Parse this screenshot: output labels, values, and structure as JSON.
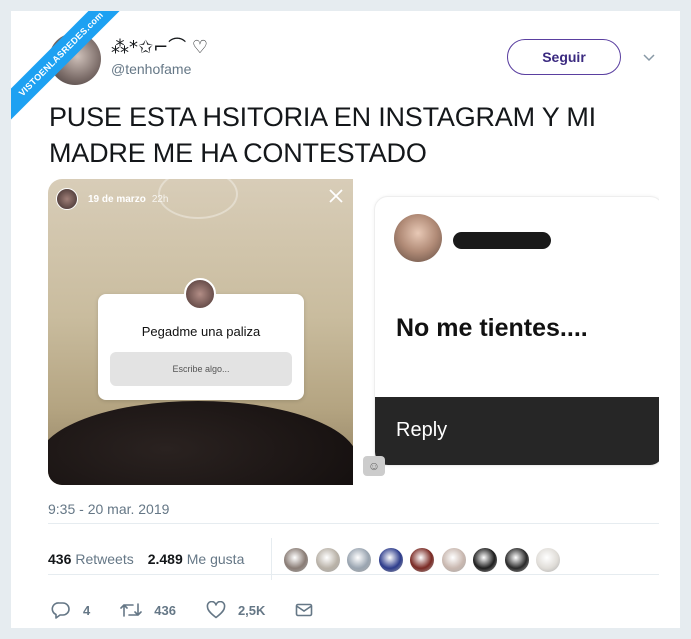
{
  "watermark": "VISTOENLASREDES.com",
  "author": {
    "display_name": "⁂*✩⌐⌒ ♡",
    "handle": "@tenhofame"
  },
  "follow_label": "Seguir",
  "tweet_text": "PUSE ESTA HSITORIA EN INSTAGRAM Y MI MADRE ME HA CONTESTADO",
  "story": {
    "date": "19 de marzo",
    "time": "22h",
    "question": "Pegadme una paliza",
    "placeholder": "Escribe algo..."
  },
  "reply_card": {
    "message": "No me tientes....",
    "reply_label": "Reply"
  },
  "timestamp": "9:35 - 20 mar. 2019",
  "stats": {
    "retweets_count": "436",
    "retweets_label": "Retweets",
    "likes_count": "2.489",
    "likes_label": "Me gusta"
  },
  "actions": {
    "replies": "4",
    "retweets": "436",
    "likes": "2,5K"
  },
  "colors": {
    "accent": "#1da1f2",
    "follow_border": "#5a3fa0",
    "text_secondary": "#657786"
  },
  "liker_colors": [
    "#8a7d76",
    "#b9b2a8",
    "#9aa5b1",
    "#2d3c8c",
    "#7a2a24",
    "#c9b8b0",
    "#1f1f1f",
    "#2a2a2a",
    "#e0ddd8"
  ]
}
